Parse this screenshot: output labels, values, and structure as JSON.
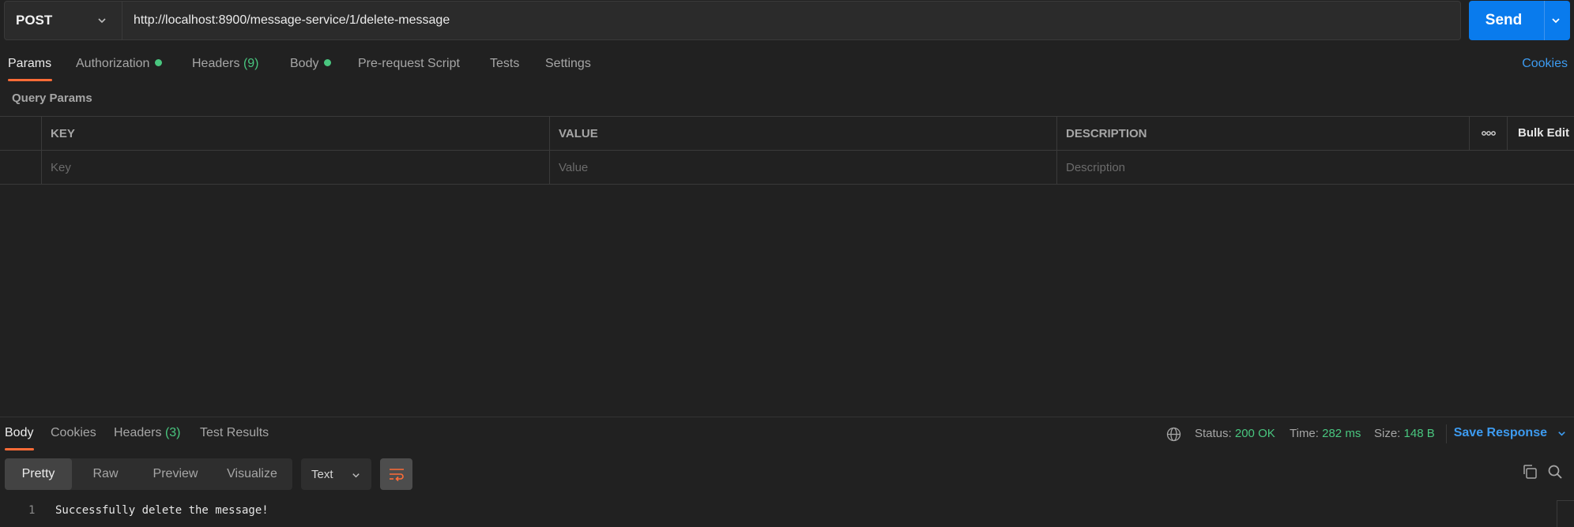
{
  "request": {
    "method": "POST",
    "url": "http://localhost:8900/message-service/1/delete-message",
    "send_label": "Send"
  },
  "request_tabs": [
    {
      "label": "Params"
    },
    {
      "label": "Authorization"
    },
    {
      "label": "Headers",
      "count": "(9)"
    },
    {
      "label": "Body"
    },
    {
      "label": "Pre-request Script"
    },
    {
      "label": "Tests"
    },
    {
      "label": "Settings"
    }
  ],
  "cookies_label": "Cookies",
  "query_params": {
    "title": "Query Params",
    "columns": [
      "KEY",
      "VALUE",
      "DESCRIPTION"
    ],
    "placeholders": [
      "Key",
      "Value",
      "Description"
    ],
    "bulk_edit": "Bulk Edit"
  },
  "response": {
    "tabs": [
      {
        "label": "Body"
      },
      {
        "label": "Cookies"
      },
      {
        "label": "Headers",
        "count": "(3)"
      },
      {
        "label": "Test Results"
      }
    ],
    "status_label": "Status:",
    "status_value": "200 OK",
    "time_label": "Time:",
    "time_value": "282 ms",
    "size_label": "Size:",
    "size_value": "148 B",
    "save_label": "Save Response",
    "formats": [
      "Pretty",
      "Raw",
      "Preview",
      "Visualize"
    ],
    "type": "Text",
    "line_number": "1",
    "body": "Successfully delete the message!"
  },
  "colors": {
    "accent": "#ff6c37",
    "send": "#097bed",
    "link": "#3d9bf0",
    "success": "#49c67f"
  },
  "icons": [
    "chevron-down-icon",
    "more-horizontal-icon",
    "globe-icon",
    "wrap-lines-icon",
    "copy-icon",
    "search-icon"
  ]
}
